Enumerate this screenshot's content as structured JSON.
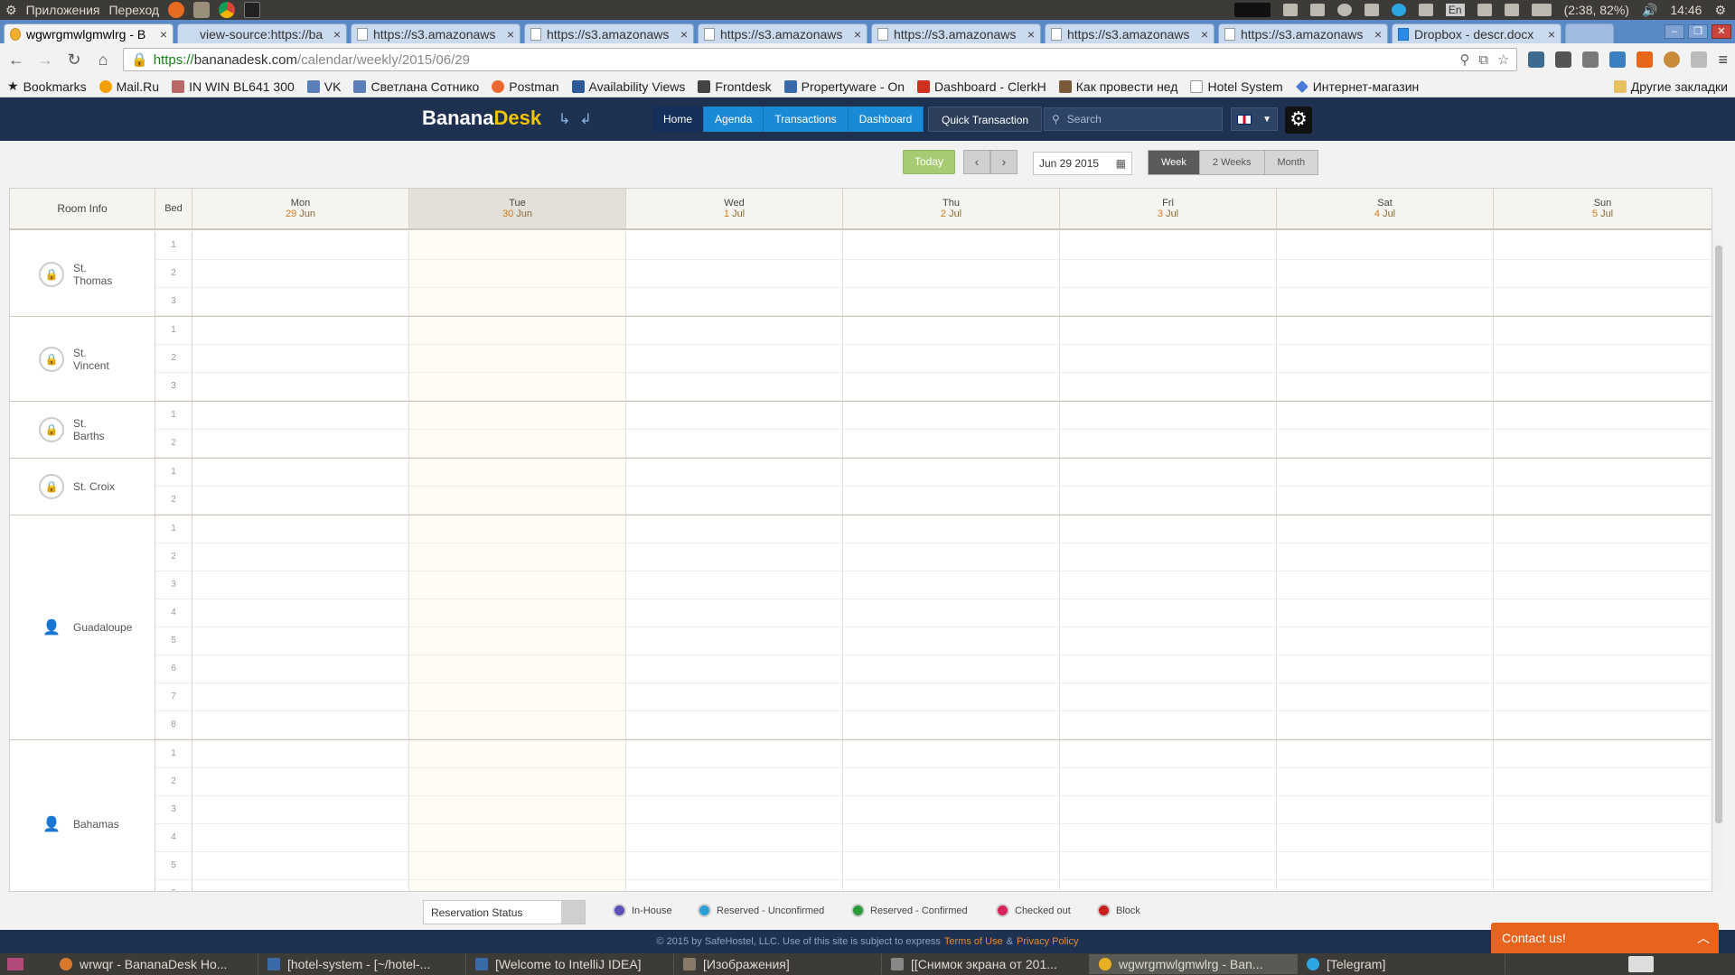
{
  "os": {
    "menu": [
      "Приложения",
      "Переход"
    ],
    "battery": "(2:38, 82%)",
    "time": "14:46",
    "lang": "En"
  },
  "tabs": [
    {
      "title": "wgwrgmwlgmwlrg - B",
      "active": true
    },
    {
      "title": "view-source:https://ba",
      "active": false
    },
    {
      "title": "https://s3.amazonaws",
      "active": false
    },
    {
      "title": "https://s3.amazonaws",
      "active": false
    },
    {
      "title": "https://s3.amazonaws",
      "active": false
    },
    {
      "title": "https://s3.amazonaws",
      "active": false
    },
    {
      "title": "https://s3.amazonaws",
      "active": false
    },
    {
      "title": "https://s3.amazonaws",
      "active": false
    },
    {
      "title": "Dropbox - descr.docx",
      "active": false
    }
  ],
  "omnibox": {
    "scheme": "https://",
    "host": "bananadesk.com",
    "path": "/calendar/weekly/2015/06/29"
  },
  "bookmarks": [
    "Bookmarks",
    "Mail.Ru",
    "IN WIN BL641 300",
    "VK",
    "Светлана Сотнико",
    "Postman",
    "Availability Views",
    "Frontdesk",
    "Propertyware - On",
    "Dashboard - ClerkH",
    "Как провести нед",
    "Hotel System",
    "Интернет-магазин"
  ],
  "bookmarks_other": "Другие закладки",
  "app": {
    "brand_main": "Banana",
    "brand_accent": "Desk",
    "nav": [
      {
        "label": "Home",
        "active": true
      },
      {
        "label": "Agenda",
        "active": false
      },
      {
        "label": "Transactions",
        "active": false
      },
      {
        "label": "Dashboard",
        "active": false
      }
    ],
    "quick_transaction": "Quick Transaction",
    "search_placeholder": "Search"
  },
  "controls": {
    "today": "Today",
    "date": "Jun 29 2015",
    "views": [
      {
        "label": "Week",
        "active": true
      },
      {
        "label": "2 Weeks",
        "active": false
      },
      {
        "label": "Month",
        "active": false
      }
    ]
  },
  "grid": {
    "room_header": "Room Info",
    "bed_header": "Bed",
    "days": [
      {
        "name": "Mon",
        "num": "29",
        "mon": "Jun",
        "today": false
      },
      {
        "name": "Tue",
        "num": "30",
        "mon": "Jun",
        "today": true
      },
      {
        "name": "Wed",
        "num": "1",
        "mon": "Jul",
        "today": false
      },
      {
        "name": "Thu",
        "num": "2",
        "mon": "Jul",
        "today": false
      },
      {
        "name": "Fri",
        "num": "3",
        "mon": "Jul",
        "today": false
      },
      {
        "name": "Sat",
        "num": "4",
        "mon": "Jul",
        "today": false
      },
      {
        "name": "Sun",
        "num": "5",
        "mon": "Jul",
        "today": false
      }
    ],
    "rooms": [
      {
        "name": "St.\nThomas",
        "icon": "lock-icon",
        "beds": 3
      },
      {
        "name": "St.\nVincent",
        "icon": "lock-icon",
        "beds": 3
      },
      {
        "name": "St.\nBarths",
        "icon": "lock-icon",
        "beds": 2
      },
      {
        "name": "St. Croix",
        "icon": "lock-icon",
        "beds": 2
      },
      {
        "name": "Guadaloupe",
        "icon": "person-icon",
        "beds": 8
      },
      {
        "name": "Bahamas",
        "icon": "person-icon",
        "beds": 6
      }
    ]
  },
  "legend": {
    "select_label": "Reservation Status",
    "items": [
      {
        "label": "In-House",
        "color": "#5b4fb8"
      },
      {
        "label": "Reserved - Unconfirmed",
        "color": "#2a9fd6"
      },
      {
        "label": "Reserved - Confirmed",
        "color": "#2a9a3a"
      },
      {
        "label": "Checked out",
        "color": "#d6245a"
      },
      {
        "label": "Block",
        "color": "#c81e1e"
      }
    ]
  },
  "footer": {
    "text": "© 2015 by SafeHostel, LLC. Use of this site is subject to express",
    "terms": "Terms of Use",
    "amp": "&",
    "privacy": "Privacy Policy"
  },
  "contact": "Contact us!",
  "taskbar": [
    {
      "label": "wrwqr - BananaDesk Ho...",
      "active": false
    },
    {
      "label": "[hotel-system - [~/hotel-...",
      "active": false
    },
    {
      "label": "[Welcome to IntelliJ IDEA]",
      "active": false
    },
    {
      "label": "[Изображения]",
      "active": false
    },
    {
      "label": "[[Снимок экрана от 201...",
      "active": false
    },
    {
      "label": "wgwrgmwlgmwlrg - Ban...",
      "active": true
    },
    {
      "label": "[Telegram]",
      "active": false
    }
  ]
}
